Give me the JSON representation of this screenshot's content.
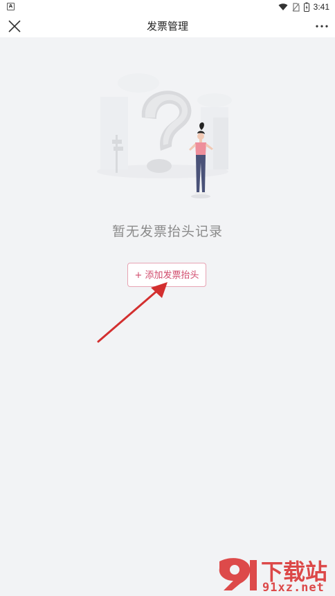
{
  "status_bar": {
    "left_icon_letter": "A",
    "time": "3:41",
    "icons": [
      "wifi-icon",
      "no-sim-icon",
      "battery-charging-icon"
    ]
  },
  "header": {
    "title": "发票管理",
    "close_icon": "close-icon",
    "more_icon": "more-dots-icon"
  },
  "main": {
    "empty_message": "暂无发票抬头记录",
    "add_button_label": "+ 添加发票抬头"
  },
  "watermark": {
    "logo_text": "下载站",
    "url_text": "91xz.net"
  },
  "colors": {
    "background": "#f2f3f5",
    "accent": "#d04a6b",
    "accent_border": "#e7a3b3",
    "annotation_arrow": "#d32f2f",
    "watermark": "#d92b2b"
  }
}
